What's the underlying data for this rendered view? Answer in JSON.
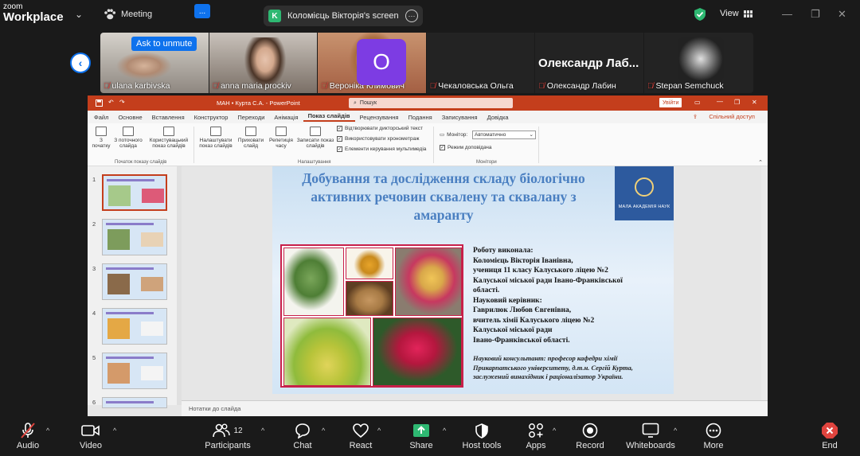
{
  "app": {
    "logo_line1": "zoom",
    "logo_line2": "Workplace",
    "meeting_label": "Meeting",
    "share_badge": "K",
    "share_title": "Коломієць Вікторія's screen",
    "view_label": "View"
  },
  "participants": {
    "unmute_label": "Ask to unmute",
    "unmute_more": "...",
    "avatar_letter": "O",
    "big_name": "Олександр Лаб...",
    "tiles": [
      {
        "name": "ulana karbivska",
        "muted": true
      },
      {
        "name": "anna maria prockiv",
        "muted": true
      },
      {
        "name": "Вероніка Климович",
        "muted": true
      },
      {
        "name": "Чекаловська Ольга",
        "muted": true
      },
      {
        "name": "Олександр Лабин",
        "muted": true
      },
      {
        "name": "Stepan Semchuck",
        "muted": true
      }
    ]
  },
  "ppt": {
    "window_title": "МАН • Курта С.А. - PowerPoint",
    "search_placeholder": "Пошук",
    "enter_label": "Увійти",
    "share_access": "Спільний доступ",
    "tabs": [
      "Файл",
      "Основне",
      "Вставлення",
      "Конструктор",
      "Переходи",
      "Анімація",
      "Показ слайдів",
      "Рецензування",
      "Подання",
      "Записування",
      "Довідка"
    ],
    "active_tab": "Показ слайдів",
    "ribbon": {
      "from_start": "З початку",
      "from_current": "З поточного слайда",
      "custom_show": "Користувацький показ слайдів",
      "group_start": "Початок показу слайдів",
      "setup_show": "Налаштувати показ слайдів",
      "hide_slide": "Приховати слайд",
      "rehearse": "Репетиція часу",
      "record": "Записати показ слайдів",
      "chk_narration": "Відтворювати дикторський текст",
      "chk_timings": "Використовувати хронометраж",
      "chk_media": "Елементи керування мультимедіа",
      "group_setup": "Налаштування",
      "monitor_label": "Монітор:",
      "monitor_value": "Автоматично",
      "presenter_view": "Режим доповідача",
      "group_monitors": "Монітори"
    },
    "thumb_numbers": [
      "1",
      "2",
      "3",
      "4",
      "5",
      "6"
    ],
    "notes_placeholder": "Нотатки до слайда"
  },
  "slide": {
    "title": "Добування та дослідження складу біологічно активних речовин сквалену та сквалану з амаранту",
    "logo_text": "МАЛА АКАДЕМІЯ НАУК",
    "author_lines": [
      "Роботу виконала:",
      "Коломієць Вікторія Іванівна,",
      "учениця 11 класу Калуського ліцею №2",
      "Калуської міської ради Івано-Франківської",
      "області.",
      "Науковий керівник:",
      "Гаврилюк Любов Євгенівна,",
      "вчитель хімії Калуського ліцею №2",
      "Калуської міської ради",
      "Івано-Франківської області."
    ],
    "consultant": "Науковий консультант: професор кафедри хімії Прикарпатського університету, д.т.н. Сергій Курта, заслужений винахідник і раціоналізатор України."
  },
  "toolbar": {
    "audio": "Audio",
    "video": "Video",
    "participants": "Participants",
    "participants_count": "12",
    "chat": "Chat",
    "react": "React",
    "share": "Share",
    "host_tools": "Host tools",
    "apps": "Apps",
    "record": "Record",
    "whiteboards": "Whiteboards",
    "more": "More",
    "end": "End"
  },
  "colors": {
    "zoom_blue": "#0e72ed",
    "ppt_red": "#c43e1c",
    "share_green": "#2eb872",
    "avatar_purple": "#7d3ce3",
    "end_red": "#e0443e"
  }
}
